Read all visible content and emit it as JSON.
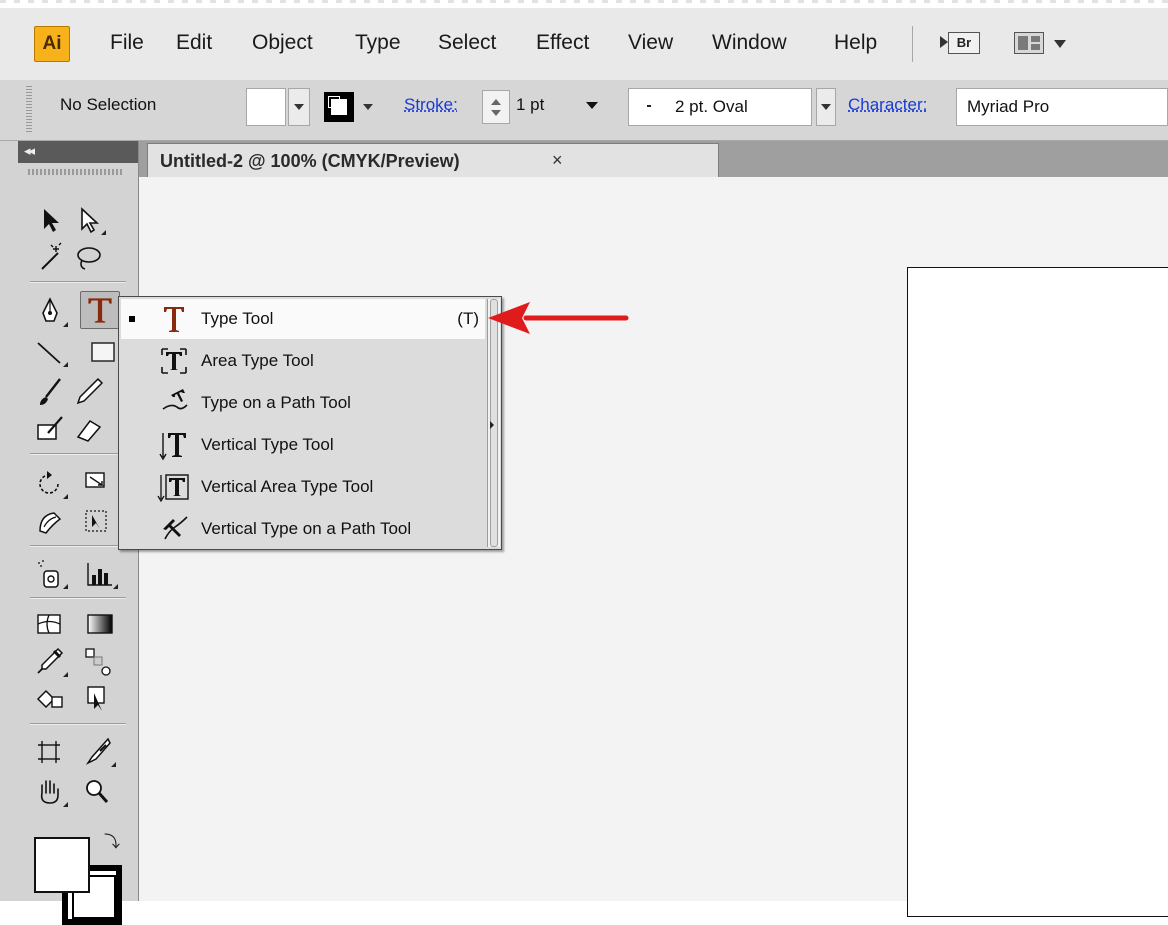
{
  "app": {
    "logo_text": "Ai",
    "menus": [
      "File",
      "Edit",
      "Object",
      "Type",
      "Select",
      "Effect",
      "View",
      "Window",
      "Help"
    ],
    "bridge_label": "Br"
  },
  "control_bar": {
    "selection_label": "No Selection",
    "stroke_link": "Stroke:",
    "stroke_weight": "1 pt",
    "brush_label": "2 pt. Oval",
    "character_link": "Character:",
    "font_name": "Myriad Pro"
  },
  "document": {
    "tab_title": "Untitled-2 @ 100% (CMYK/Preview)",
    "close_glyph": "×"
  },
  "toolbox": {
    "collapse_glyph": "◂◂",
    "swap_glyph": "⤵"
  },
  "flyout": {
    "items": [
      {
        "label": "Type Tool",
        "shortcut": "(T)",
        "active": true,
        "icon": "type-tool-icon"
      },
      {
        "label": "Area Type Tool",
        "icon": "area-type-tool-icon"
      },
      {
        "label": "Type on a Path Tool",
        "icon": "type-on-path-tool-icon"
      },
      {
        "label": "Vertical Type Tool",
        "icon": "vertical-type-tool-icon"
      },
      {
        "label": "Vertical Area Type Tool",
        "icon": "vertical-area-type-tool-icon"
      },
      {
        "label": "Vertical Type on a Path Tool",
        "icon": "vertical-type-on-path-tool-icon"
      }
    ]
  },
  "colors": {
    "logo_bg": "#f7b21b",
    "link_blue": "#1a3ad6",
    "annotation_arrow": "#e01b1b",
    "type_icon": "#8a2a0c"
  }
}
